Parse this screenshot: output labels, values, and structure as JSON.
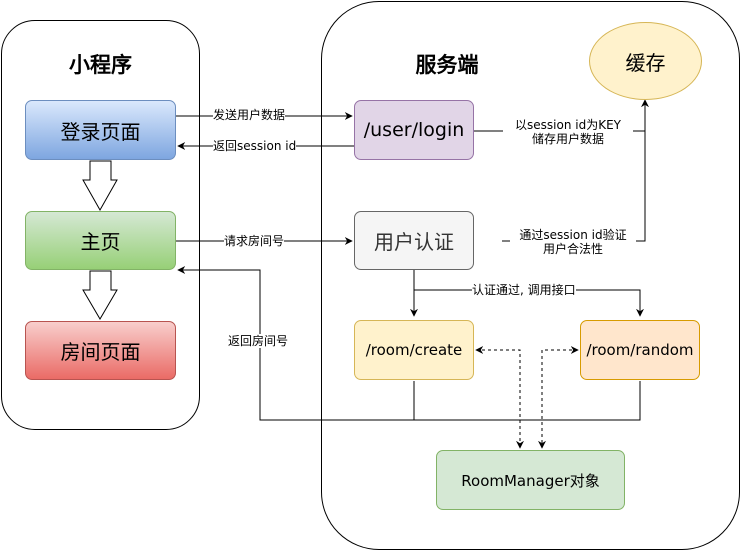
{
  "mini_program": {
    "title": "小程序",
    "login_page": "登录页面",
    "home_page": "主页",
    "room_page": "房间页面"
  },
  "server": {
    "title": "服务端",
    "cache": "缓存",
    "login_endpoint": "/user/login",
    "auth": "用户认证",
    "room_create": "/room/create",
    "room_random": "/room/random",
    "room_manager": "RoomManager对象"
  },
  "edge_labels": {
    "send_user_data": "发送用户数据",
    "return_session": "返回session id",
    "store_line1": "以session id为KEY",
    "store_line2": "储存用户数据",
    "request_room": "请求房间号",
    "verify_line1": "通过session id验证",
    "verify_line2": "用户合法性",
    "auth_passed": "认证通过, 调用接口",
    "return_room": "返回房间号"
  },
  "colors": {
    "login_fill": "#7ea6e0",
    "login_stroke": "#6c8ebf",
    "home_fill": "#97d077",
    "home_stroke": "#82b366",
    "room_fill": "#ea6b66",
    "room_stroke": "#b85450",
    "purple_fill": "#e1d5e7",
    "purple_stroke": "#9673a6",
    "gray_fill": "#f5f5f5",
    "gray_stroke": "#666666",
    "yellow_fill": "#fff2cc",
    "yellow_stroke": "#d6b656",
    "orange_fill": "#ffe6cc",
    "orange_stroke": "#d79b00",
    "green_fill": "#d5e8d4",
    "green_stroke": "#82b366"
  }
}
